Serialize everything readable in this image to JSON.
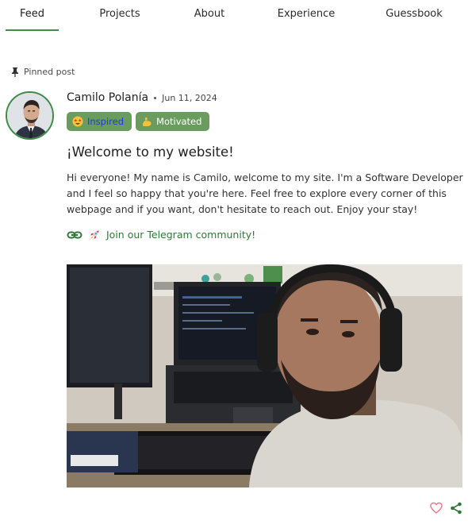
{
  "nav": {
    "tabs": [
      {
        "label": "Feed",
        "active": true
      },
      {
        "label": "Projects",
        "active": false
      },
      {
        "label": "About",
        "active": false
      },
      {
        "label": "Experience",
        "active": false
      },
      {
        "label": "Guessbook",
        "active": false
      }
    ]
  },
  "post": {
    "pinned_label": "Pinned post",
    "author": "Camilo Polanía",
    "date": "Jun 11, 2024",
    "badges": [
      {
        "label": "Inspired",
        "icon": "star-struck-emoji-icon"
      },
      {
        "label": "Motivated",
        "icon": "flexed-biceps-emoji-icon"
      }
    ],
    "title": "¡Welcome to my website!",
    "body": "Hi everyone! My name is Camilo, welcome to my site. I'm a Software Developer and I feel so happy that you're here. Feel free to explore every corner of this webpage and if you want, don't hesitate to reach out. Enjoy your stay!",
    "link": {
      "icon": "rocket-icon",
      "text": "Join our Telegram community!"
    },
    "actions": {
      "like_icon": "heart-icon",
      "share_icon": "share-icon"
    }
  },
  "colors": {
    "accent_green": "#3f8f46",
    "badge_green": "#6b9c5f",
    "link_green": "#2f7a36",
    "heart_pink": "#e57a8c",
    "inspired_text": "#1e3bd6"
  }
}
